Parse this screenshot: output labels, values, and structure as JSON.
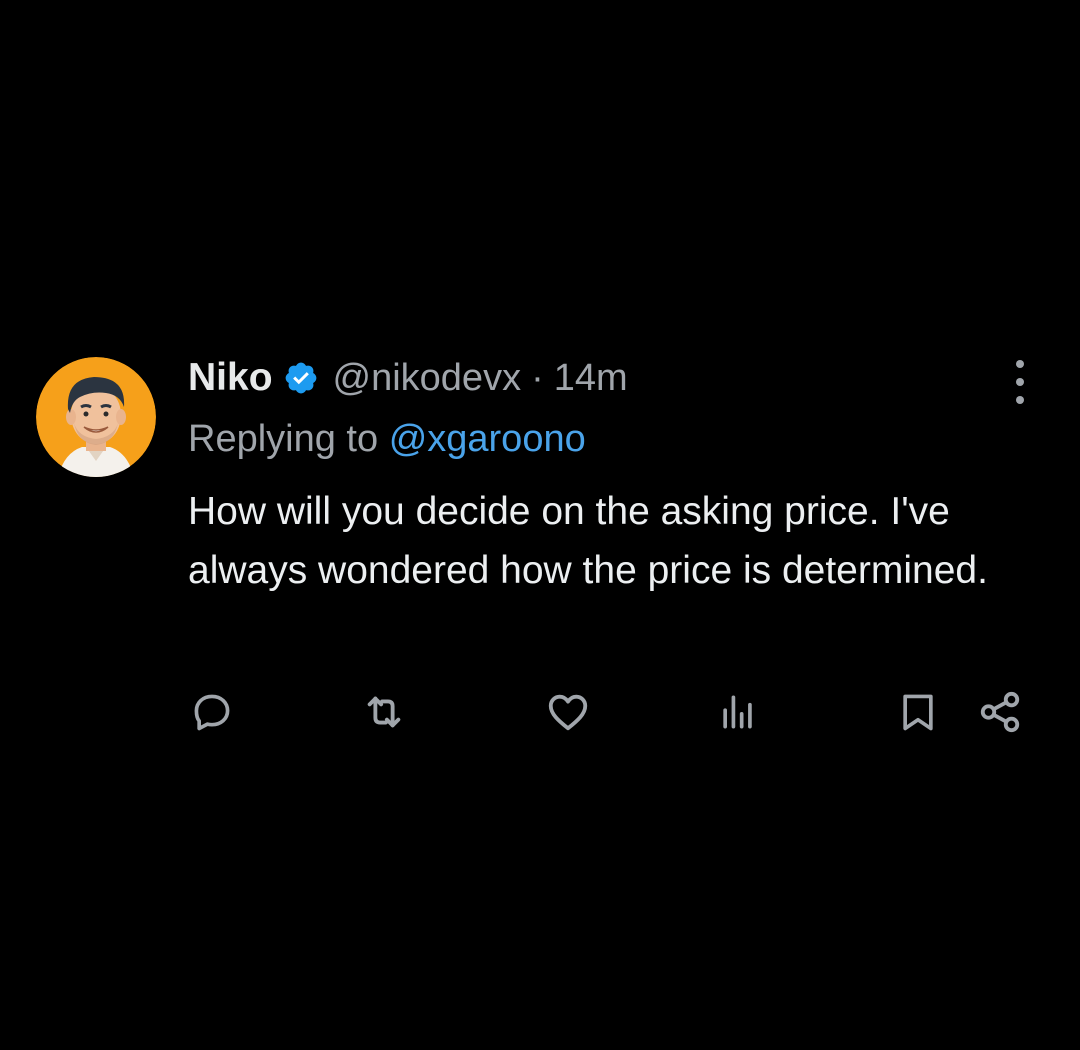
{
  "tweet": {
    "display_name": "Niko",
    "handle": "@nikodevx",
    "separator": "·",
    "time": "14m",
    "replying_prefix": "Replying to",
    "replying_to": "@xgaroono",
    "text": "How will you decide on the asking price. I've always wondered how the price is determined."
  },
  "icons": {
    "verified": "verified-badge-icon",
    "more": "more-vertical-icon",
    "reply": "reply-icon",
    "retweet": "retweet-icon",
    "like": "heart-icon",
    "views": "views-icon",
    "bookmark": "bookmark-icon",
    "share": "share-icon"
  },
  "colors": {
    "background": "#000000",
    "text": "#e7e9ea",
    "secondary": "#a0a5ab",
    "accent": "#4aa3ea",
    "verified": "#1d9bf0",
    "avatar_bg": "#f6a01a"
  }
}
